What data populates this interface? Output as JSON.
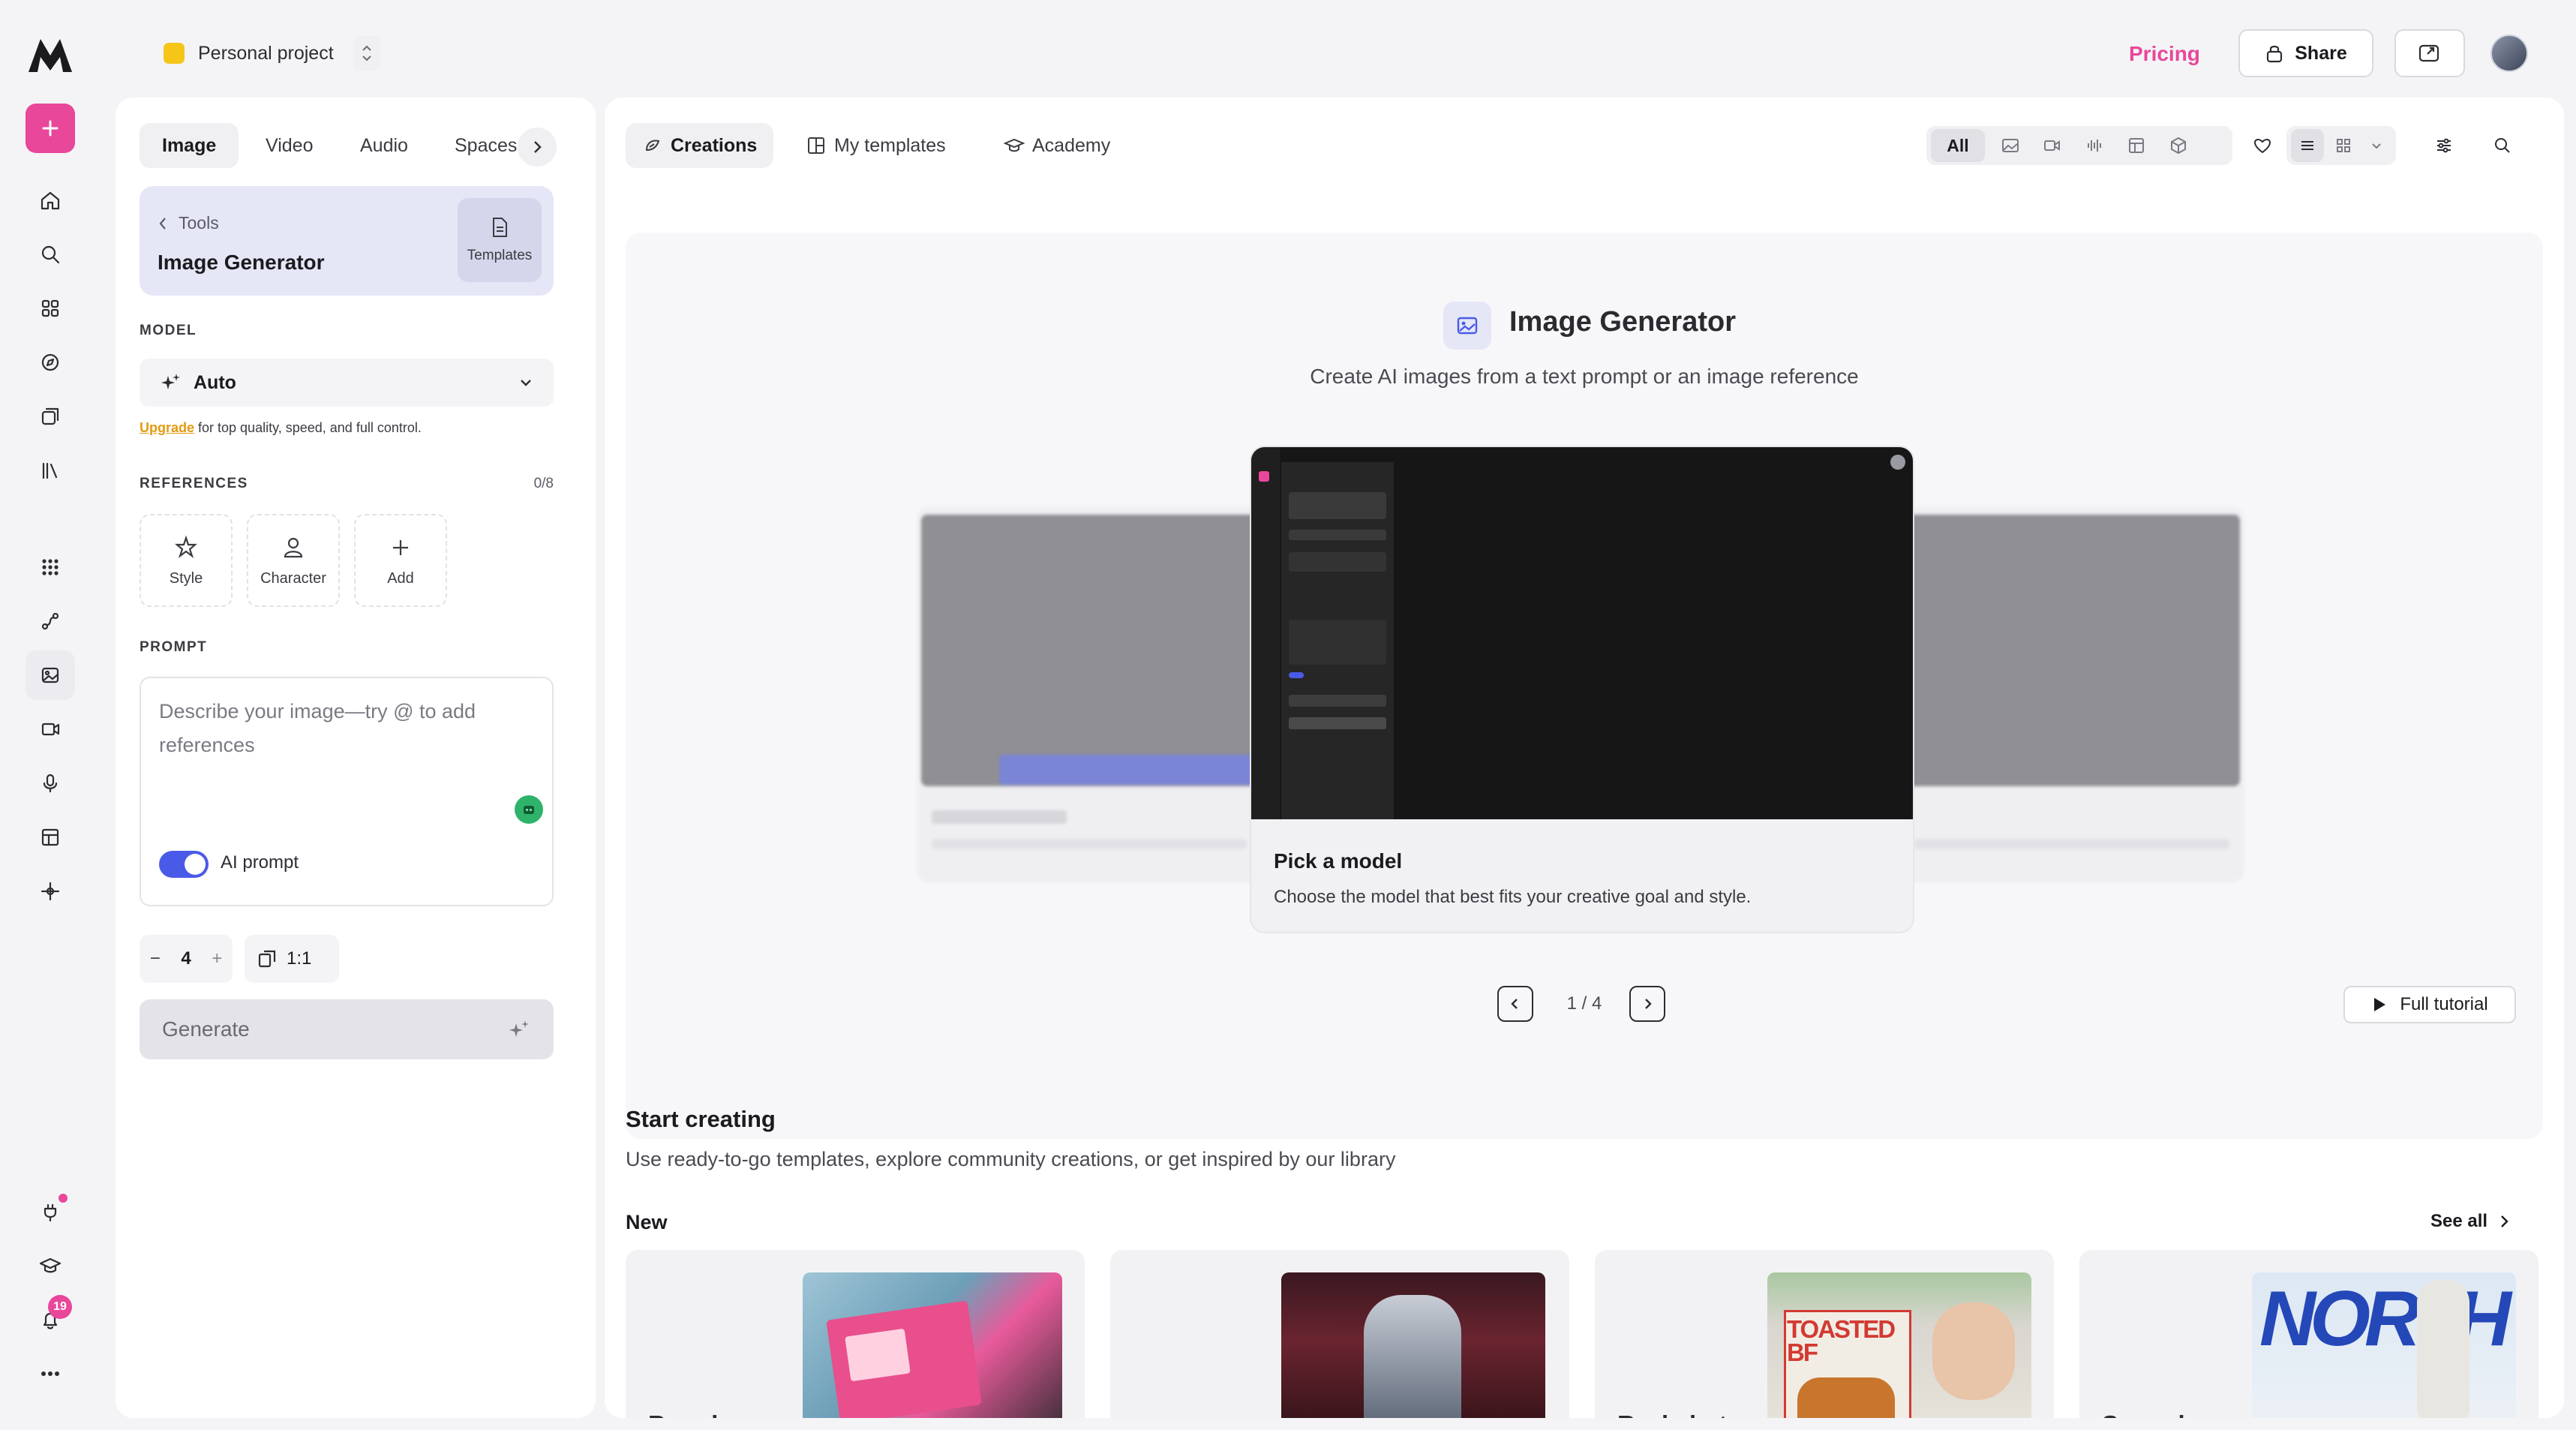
{
  "project": {
    "name": "Personal project",
    "color": "#f5c518"
  },
  "header": {
    "pricing_label": "Pricing",
    "share_label": "Share"
  },
  "rail": {
    "notification_count": "19"
  },
  "left": {
    "tabs": [
      "Image",
      "Video",
      "Audio",
      "Spaces"
    ],
    "breadcrumb": "Tools",
    "tool_title": "Image Generator",
    "templates_label": "Templates",
    "model_label": "MODEL",
    "model_value": "Auto",
    "upgrade_link": "Upgrade",
    "upgrade_text": " for top quality, speed, and full control.",
    "references_label": "REFERENCES",
    "references_count": "0/8",
    "reference_cards": [
      "Style",
      "Character",
      "Add"
    ],
    "prompt_label": "PROMPT",
    "prompt_placeholder": "Describe your image—try @ to add references",
    "ai_prompt_label": "AI prompt",
    "quantity": "4",
    "aspect_ratio": "1:1",
    "generate_label": "Generate"
  },
  "main": {
    "tabs": [
      "Creations",
      "My templates",
      "Academy"
    ],
    "filter_all": "All",
    "hero": {
      "title": "Image Generator",
      "subtitle": "Create AI images from a text prompt or an image reference",
      "card_title": "Pick a model",
      "card_desc": "Choose the model that best fits your creative goal and style.",
      "pager": "1 / 4",
      "full_tutorial": "Full tutorial"
    },
    "start_title": "Start creating",
    "start_subtitle": "Use ready-to-go templates, explore community creations, or get inspired by our library",
    "new_label": "New",
    "see_all": "See all",
    "cards": [
      "Brand",
      "",
      "Real photo",
      "Surreal"
    ],
    "card_art": {
      "toasted": "TOASTED BF",
      "north": "NORTH"
    }
  },
  "colors": {
    "accent": "#e8479a",
    "primary": "#4a5ae8",
    "panel_lavender": "#e5e7f7"
  }
}
